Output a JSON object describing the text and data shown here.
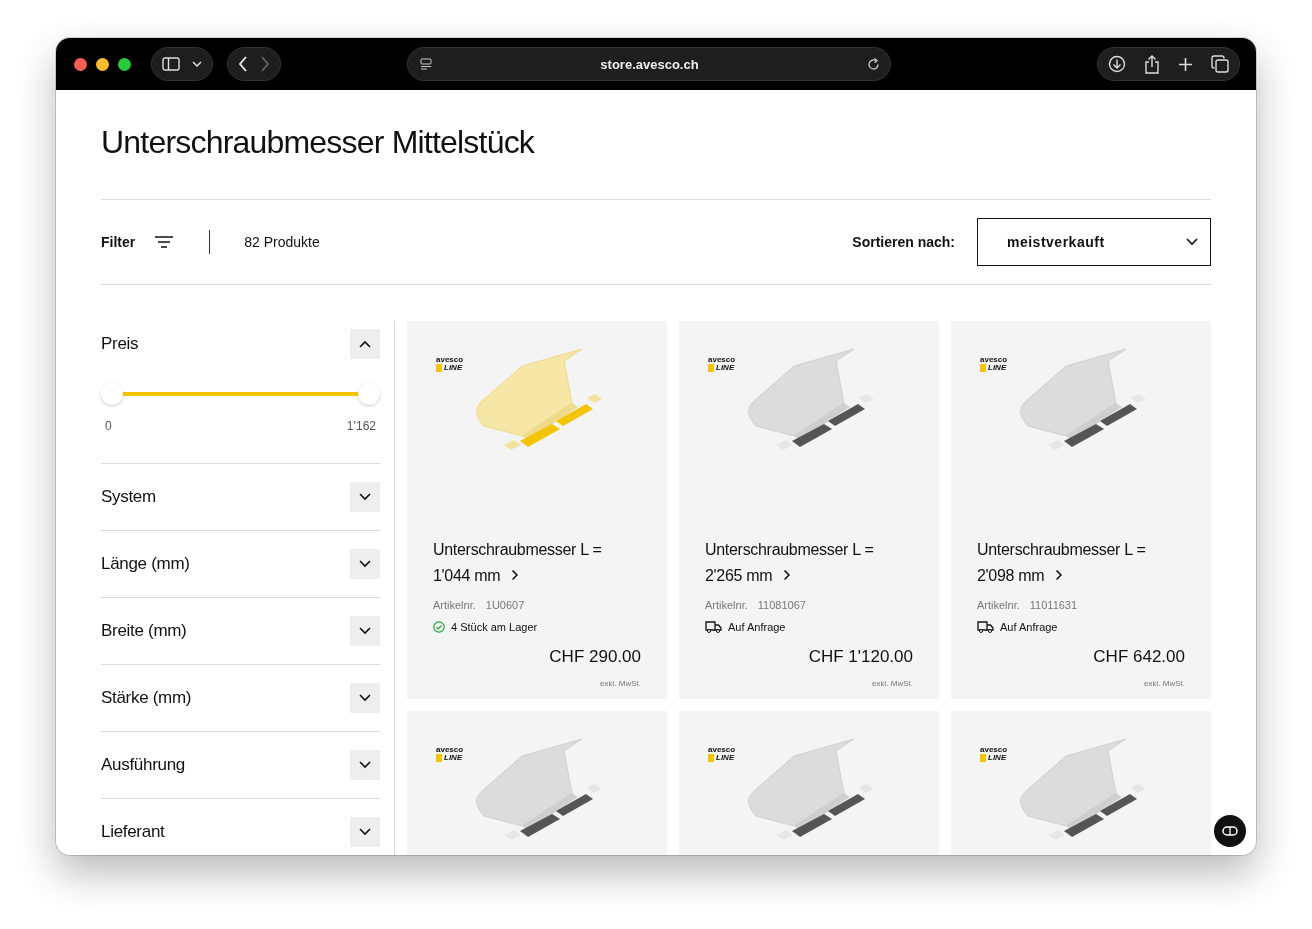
{
  "browser": {
    "url": "store.avesco.ch"
  },
  "page_title": "Unterschraubmesser Mittelstück",
  "toolbar": {
    "filter_label": "Filter",
    "count": "82 Produkte",
    "sort_label": "Sortieren nach:",
    "sort_value": "meistverkauft"
  },
  "filters": [
    {
      "label": "Preis",
      "expanded": true,
      "range_start": {
        "level": 0
      },
      "range_end": {
        "level": 1
      },
      "min_label": "0",
      "max_label": "1’162"
    },
    {
      "label": "System",
      "expanded": false
    },
    {
      "label": "Länge (mm)",
      "expanded": false
    },
    {
      "label": "Breite (mm)",
      "expanded": false
    },
    {
      "label": "Stärke (mm)",
      "expanded": false
    },
    {
      "label": "Ausführung",
      "expanded": false
    },
    {
      "label": "Lieferant",
      "expanded": false
    }
  ],
  "products": [
    {
      "kind": "colored",
      "logo_top": "avesco",
      "logo_bottom": "LINE",
      "name": "Unterschraubmesser L = 1'044 mm",
      "sku_label": "Artikelnr.",
      "sku": "1U0607",
      "stock": {
        "kind": "in_stock",
        "text": "4 Stück am Lager"
      },
      "price": "CHF 290.00",
      "tax_note": "exkl. MwSt."
    },
    {
      "kind": "muted",
      "logo_top": "avesco",
      "logo_bottom": "LINE",
      "name": "Unterschraubmesser L = 2'265 mm",
      "sku_label": "Artikelnr.",
      "sku": "11081067",
      "stock": {
        "kind": "on_request",
        "text": "Auf Anfrage"
      },
      "price": "CHF 1'120.00",
      "tax_note": "exkl. MwSt."
    },
    {
      "kind": "muted",
      "logo_top": "avesco",
      "logo_bottom": "LINE",
      "name": "Unterschraubmesser L = 2'098 mm",
      "sku_label": "Artikelnr.",
      "sku": "11011631",
      "stock": {
        "kind": "on_request",
        "text": "Auf Anfrage"
      },
      "price": "CHF 642.00",
      "tax_note": "exkl. MwSt."
    },
    {
      "kind": "muted",
      "logo_top": "avesco",
      "logo_bottom": "LINE"
    },
    {
      "kind": "muted",
      "logo_top": "avesco",
      "logo_bottom": "LINE"
    },
    {
      "kind": "muted",
      "logo_top": "avesco",
      "logo_bottom": "LINE"
    }
  ]
}
